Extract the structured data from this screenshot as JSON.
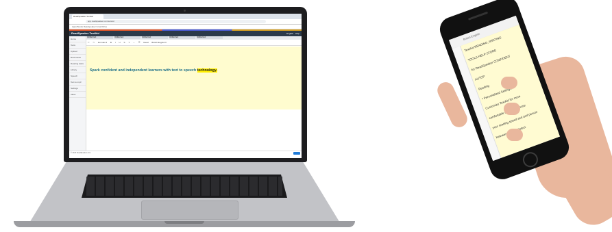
{
  "laptop": {
    "browser_tab": "ReadSpeaker TextAid",
    "url": "app.readspeaker.com/textaid",
    "bookmarks": "Apps  Books  Readspeaker  Gmail  Drive",
    "app_title": "ReadSpeaker TextAid",
    "header_lang": "English",
    "header_help": "Help",
    "sidebar": [
      "Home",
      "Texts",
      "Upload",
      "Bookmarks",
      "Reading tasks",
      "Library",
      "Speech",
      "Text to mp3",
      "Settings",
      "Ideas"
    ],
    "doc_tabs": [
      "Untitled text",
      "Untitled text",
      "Untitled text",
      "Untitled text",
      "Untitled text"
    ],
    "toolbar_items": [
      "↶",
      "↷",
      "Formats ▾",
      "B",
      "I",
      "U",
      "S",
      "T",
      "↔",
      "☰",
      "Read",
      "British English ▾"
    ],
    "editor_text_pre": "Spark confident and independent learners with text to speech ",
    "editor_text_highlight": "technology.",
    "footer": "© 2023 ReadSpeaker.com"
  },
  "phone": {
    "toolbar": "British English",
    "lines": [
      "TextAid READING, WRITING",
      "TOOLS HELP STORE",
      "for ReadSpeaker CONFIDENT",
      "AUTOP",
      "Reading",
      "• Personalized Settings:",
      "Customize TextAid for more",
      "comfortable reading. Choose",
      "your reading speed and and person",
      "between modes. Select"
    ]
  }
}
